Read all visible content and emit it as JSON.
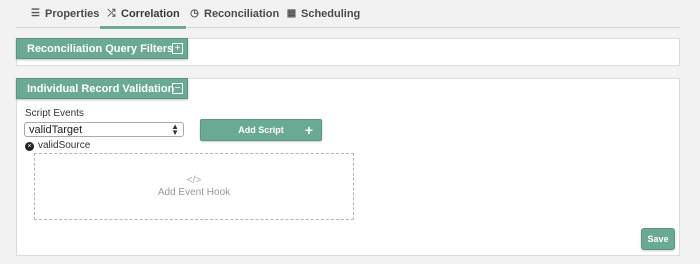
{
  "tabs": [
    {
      "label": "Properties",
      "icon": "list-icon"
    },
    {
      "label": "Correlation",
      "icon": "shuffle-icon"
    },
    {
      "label": "Reconciliation",
      "icon": "clock-icon"
    },
    {
      "label": "Scheduling",
      "icon": "calendar-icon"
    }
  ],
  "active_tab": "Correlation",
  "query_filters": {
    "title": "Reconciliation Query Filters",
    "toggle": "+"
  },
  "validation": {
    "title": "Individual Record Validation",
    "toggle": "−",
    "script_events_label": "Script Events",
    "selected_event": "validTarget",
    "add_script_label": "Add Script",
    "add_script_icon": "+",
    "event_entry": "validSource",
    "remove_icon": "×",
    "hook_icon_text": "</>",
    "hook_label": "Add Event Hook",
    "save_label": "Save"
  },
  "colors": {
    "accent": "#6aa994",
    "background": "#f2f2f2"
  }
}
